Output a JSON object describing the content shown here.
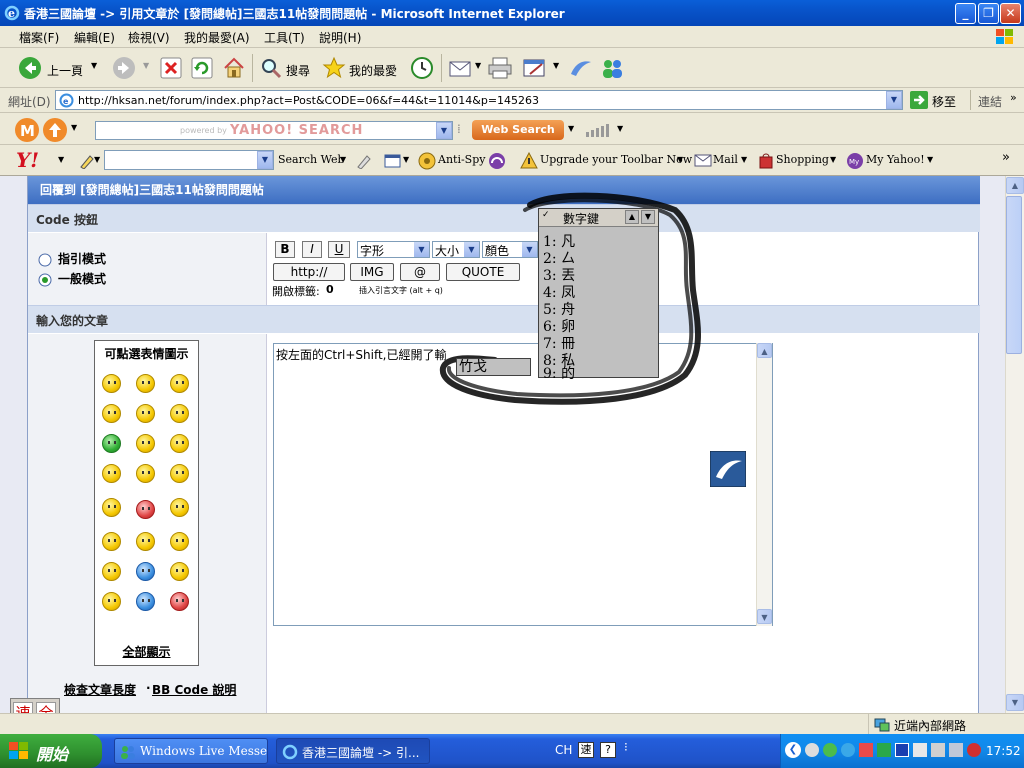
{
  "window": {
    "title": "香港三國論壇 -> 引用文章於 [發問總帖]三國志11帖發問問題帖 - Microsoft Internet Explorer",
    "buttons": {
      "minimize": "_",
      "restore": "❐",
      "close": "✕"
    }
  },
  "menu": [
    "檔案(F)",
    "編輯(E)",
    "檢視(V)",
    "我的最愛(A)",
    "工具(T)",
    "說明(H)"
  ],
  "toolbar": {
    "back": "上一頁",
    "search": "搜尋",
    "favorites": "我的最愛"
  },
  "address": {
    "label": "網址(D)",
    "url": "http://hksan.net/forum/index.php?act=Post&CODE=06&f=44&t=11014&p=145263",
    "go": "移至",
    "links": "連結"
  },
  "yahoo_search": {
    "placeholder": "YAHOO! SEARCH",
    "powered": "powered by",
    "button": "Web Search"
  },
  "yahoo_toolbar": {
    "search_web": "Search Web",
    "antispy": "Anti-Spy",
    "upgrade": "Upgrade your Toolbar Now",
    "mail": "Mail",
    "shopping": "Shopping",
    "myyahoo": "My Yahoo!"
  },
  "form": {
    "reply_heading": "回覆到 [發問總帖]三國志11帖發問問題帖",
    "code_buttons_heading": "Code 按鈕",
    "mode_quote": "指引模式",
    "mode_normal": "一般模式",
    "font_buttons": [
      "B",
      "I",
      "U"
    ],
    "font_select": "字形",
    "size_select": "大小",
    "color_select": "顏色",
    "tag_buttons": [
      "http://",
      "IMG",
      "@",
      "QUOTE"
    ],
    "open_tags_label": "開啟標籤:",
    "open_tags_count": "0",
    "insert_quote_hint": "插入引言文字 (alt + q)",
    "enter_post_heading": "輸入您的文章",
    "emoticons_title": "可點選表情圖示",
    "show_all": "全部顯示",
    "check_length": "檢查文章長度",
    "dot": "·",
    "bbcode_help": "BB Code 說明",
    "textarea_text": "按左面的Ctrl+Shift,已經開了輸"
  },
  "ime": {
    "header": "數字鍵",
    "candidates": [
      "1: 凡",
      "2: 厶",
      "3: 丟",
      "4: 凤",
      "5: 舟",
      "6: 卵",
      "7: 冊",
      "8: 私",
      "9: 的"
    ],
    "composition": "竹戈",
    "buttons": [
      "速",
      "全"
    ]
  },
  "status": {
    "zone": "近端內部網路"
  },
  "taskbar": {
    "start": "開始",
    "items": [
      "Windows Live Messen...",
      "香港三國論壇 -> 引..."
    ],
    "lang": "CH",
    "clock": "17:52"
  },
  "colors": {
    "title_blue": "#0853c9",
    "start_green": "#2e8f2e",
    "header_blue": "#4a7ccc",
    "row_blue": "#d6e0f0"
  }
}
